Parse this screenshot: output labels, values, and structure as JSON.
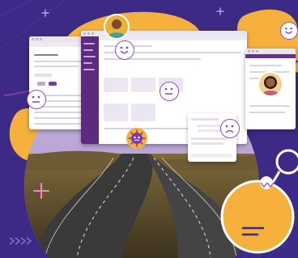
{
  "scene": {
    "colors": {
      "background": "#3d2a86",
      "accent_orange": "#f5b13c",
      "accent_purple": "#8a4cc2",
      "window_header": "#6b2d8e",
      "journey_line": "#7b3bb0",
      "road": "#3a3a3a"
    },
    "emotions": [
      "happy-face",
      "happy-face",
      "neutral-face",
      "sad-face",
      "happy-face",
      "virus-face"
    ]
  }
}
